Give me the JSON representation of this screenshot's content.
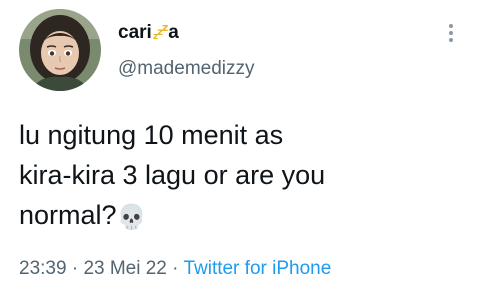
{
  "author": {
    "display_name_prefix": "cari",
    "display_name_zzz": [
      "z",
      "z",
      "z"
    ],
    "display_name_suffix": "a",
    "handle": "@mademedizzy",
    "avatar_icon": "profile-avatar"
  },
  "tweet": {
    "text": "lu ngitung 10 menit as\nkira-kira 3 lagu or are you\nnormal?",
    "emoji": "💀",
    "emoji_icon": "skull-icon"
  },
  "meta": {
    "time": "23:39",
    "separator": "·",
    "date": "23 Mei 22",
    "source": "Twitter for iPhone"
  },
  "colors": {
    "link": "#1d9bf0",
    "secondary_text": "#536471",
    "primary_text": "#0f1419",
    "zzz": "#e8b923"
  },
  "more_icon": "vertical-dots-icon"
}
